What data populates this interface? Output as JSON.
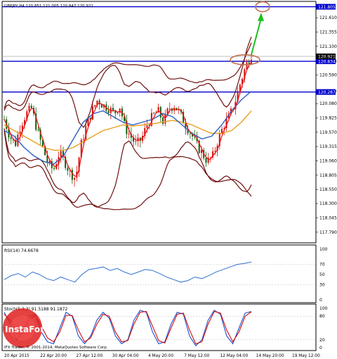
{
  "chart_data": [
    {
      "type": "candlestick",
      "header": "GBPJPY,H4  120.851 121.005 120.847 120.921",
      "y_range": [
        117.6,
        121.9
      ],
      "y_ticks": [
        "121.610",
        "121.355",
        "121.100",
        "120.834",
        "120.590",
        "120.287",
        "120.080",
        "119.825",
        "119.570",
        "119.315",
        "119.060",
        "118.805",
        "118.550",
        "118.300",
        "118.045",
        "117.790"
      ],
      "current_price_label": "120.921",
      "levels": [
        {
          "label": "121.805",
          "value": 121.805
        },
        {
          "label": "120.834",
          "value": 120.834
        },
        {
          "label": "120.287",
          "value": 120.287
        }
      ],
      "x_labels": [
        "20 Apr 2015",
        "22 Apr 20:00",
        "27 Apr 12:00",
        "30 Apr 04:00",
        "4 May 20:00",
        "7 May 12:00",
        "12 May 04:00",
        "14 May 20:00",
        "19 May 12:00"
      ],
      "price_path": [
        119.8,
        119.5,
        119.35,
        119.7,
        119.9,
        120.0,
        119.6,
        119.3,
        119.0,
        118.9,
        119.2,
        119.05,
        118.85,
        118.75,
        119.35,
        119.7,
        119.95,
        120.15,
        120.05,
        120.0,
        119.9,
        120.05,
        119.65,
        119.5,
        119.35,
        119.45,
        119.7,
        119.85,
        119.95,
        119.75,
        120.0,
        120.05,
        119.9,
        119.7,
        119.55,
        119.35,
        119.2,
        119.05,
        119.15,
        119.45,
        119.7,
        119.85,
        120.1,
        120.45,
        120.75,
        120.95
      ],
      "moving_averages": [
        {
          "name": "slow",
          "color": "#e8a020",
          "values": [
            119.7,
            119.6,
            119.5,
            119.4,
            119.3,
            119.25,
            119.25,
            119.3,
            119.4,
            119.5,
            119.6,
            119.65,
            119.7,
            119.68,
            119.7,
            119.72,
            119.75,
            119.78,
            119.75,
            119.7,
            119.62,
            119.55,
            119.55,
            119.6,
            119.75,
            119.95
          ]
        },
        {
          "name": "fast",
          "color": "#3060c0",
          "values": [
            119.6,
            119.5,
            119.3,
            119.15,
            119.05,
            119.0,
            119.15,
            119.45,
            119.75,
            119.9,
            119.95,
            119.85,
            119.75,
            119.7,
            119.75,
            119.8,
            119.9,
            119.85,
            119.7,
            119.55,
            119.45,
            119.5,
            119.7,
            119.95,
            120.15,
            120.3
          ]
        }
      ]
    },
    {
      "type": "line",
      "label": "RSI(14) 74.6678",
      "y_range": [
        0,
        100
      ],
      "y_ticks": [
        "100",
        "70",
        "50",
        "30",
        "0"
      ],
      "values": [
        40,
        48,
        52,
        45,
        55,
        50,
        42,
        38,
        45,
        40,
        35,
        50,
        60,
        62,
        65,
        58,
        62,
        55,
        50,
        55,
        60,
        58,
        52,
        45,
        40,
        35,
        38,
        45,
        42,
        48,
        55,
        60,
        65,
        70,
        72,
        74.67
      ]
    },
    {
      "type": "line",
      "label": "Stoch(5,3,3) 91.5188 91.1872",
      "y_range": [
        0,
        100
      ],
      "y_ticks": [
        "100",
        "80",
        "20",
        "0"
      ],
      "series": [
        {
          "color": "#2050d0",
          "values": [
            90,
            60,
            20,
            40,
            80,
            85,
            40,
            15,
            10,
            50,
            90,
            80,
            30,
            10,
            30,
            70,
            90,
            75,
            30,
            10,
            20,
            70,
            95,
            90,
            40,
            10,
            15,
            60,
            90,
            85,
            30,
            5,
            20,
            70,
            95,
            85,
            30,
            10,
            50,
            88,
            92
          ]
        },
        {
          "color": "#d01010",
          "values": [
            85,
            70,
            35,
            35,
            70,
            82,
            55,
            25,
            15,
            40,
            82,
            82,
            45,
            15,
            25,
            60,
            85,
            80,
            40,
            15,
            18,
            60,
            90,
            92,
            55,
            18,
            12,
            50,
            85,
            88,
            45,
            10,
            15,
            60,
            92,
            88,
            45,
            15,
            40,
            80,
            91
          ]
        }
      ]
    }
  ],
  "watermark": {
    "line1": "InstaForex"
  },
  "copyright": "IFX Trader, © 2001-2014, MetaQuotes Software Corp."
}
